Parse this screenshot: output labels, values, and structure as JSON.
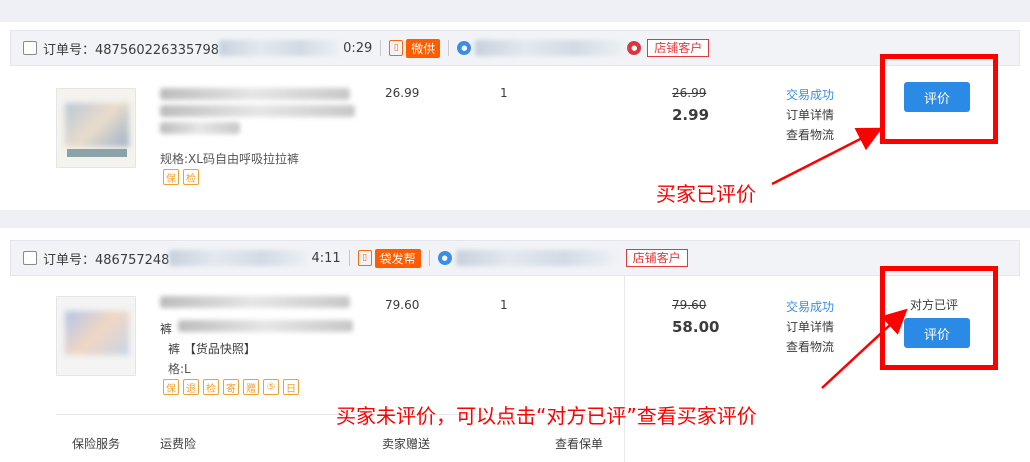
{
  "orders": [
    {
      "order_no_label": "订单号：487560226335798",
      "time": "0:29",
      "channel_tag": "微供",
      "shop_tag": "店铺客户",
      "spec": "规格:XL码自由呼吸拉拉裤",
      "unit_price": "26.99",
      "quantity": "1",
      "original_price": "26.99",
      "paid_price": "2.99",
      "status": "交易成功",
      "detail_link": "订单详情",
      "logistics_link": "查看物流",
      "evaluate_button": "评价",
      "service_icons": [
        "保",
        "检"
      ]
    },
    {
      "order_no_label": "订单号：486757248",
      "time": "4:11",
      "channel_tag": "袋发帮",
      "shop_tag": "店铺客户",
      "title_fragment_1": "裤",
      "title_fragment_2": "裤 【货品快照】",
      "spec": "格:L",
      "unit_price": "79.60",
      "quantity": "1",
      "original_price": "79.60",
      "paid_price": "58.00",
      "status": "交易成功",
      "detail_link": "订单详情",
      "logistics_link": "查看物流",
      "counterpart_evaluated": "对方已评",
      "evaluate_button": "评价",
      "service_icons": [
        "保",
        "退",
        "检",
        "寄",
        "赠",
        "⑤",
        "日"
      ]
    }
  ],
  "footer": {
    "insurance_service": "保险服务",
    "freight_insurance": "运费险",
    "seller_gift": "卖家赠送",
    "view_policy": "查看保单"
  },
  "annotations": {
    "buyer_evaluated": "买家已评价",
    "buyer_not_evaluated": "买家未评价，可以点击“对方已评”查看买家评价"
  },
  "colors": {
    "annotation_red": "#ff0000",
    "button_blue": "#2b8ae6",
    "link_blue": "#3a8ee6",
    "tag_orange": "#ff5c00",
    "shop_tag_red": "#e4393c"
  }
}
